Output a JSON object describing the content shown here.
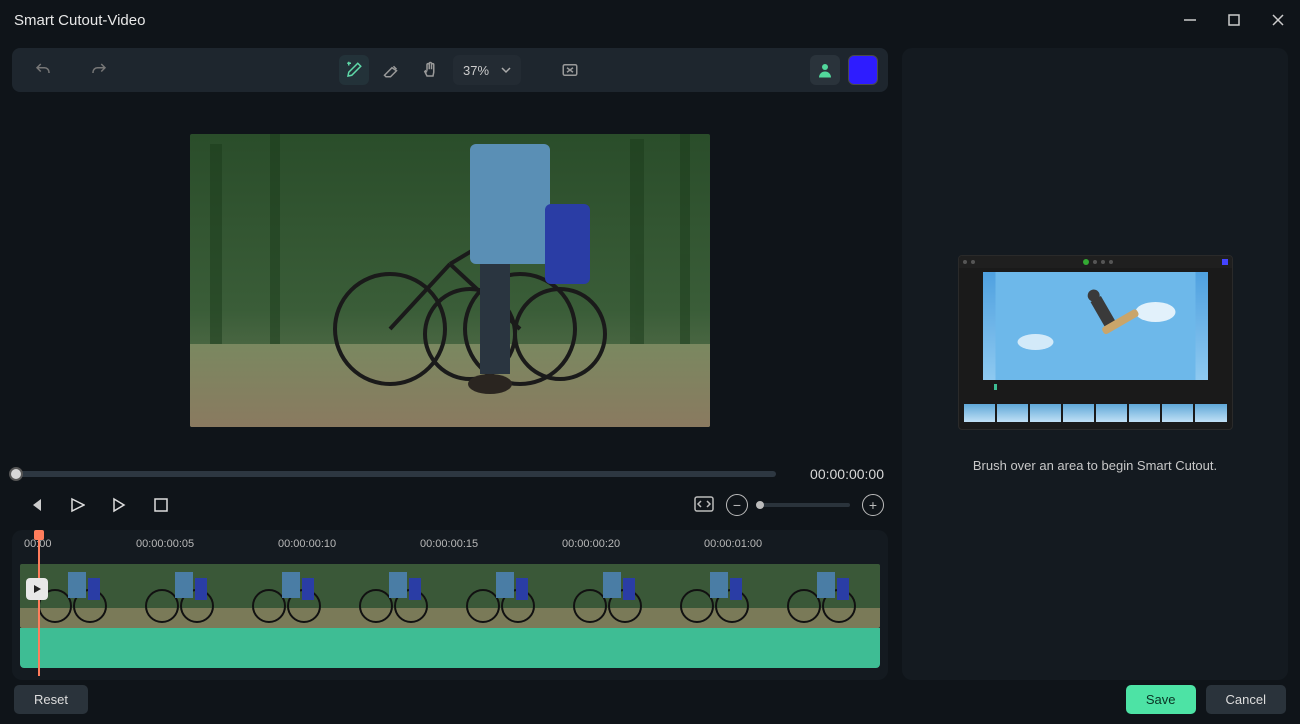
{
  "window": {
    "title": "Smart Cutout-Video"
  },
  "toolbar": {
    "zoom_value": "37%"
  },
  "playback": {
    "timecode": "00:00:00:00"
  },
  "timeline": {
    "marks": [
      "00:00",
      "00:00:00:05",
      "00:00:00:10",
      "00:00:00:15",
      "00:00:00:20",
      "00:00:01:00"
    ]
  },
  "help": {
    "message": "Brush over an area to begin Smart Cutout."
  },
  "buttons": {
    "reset": "Reset",
    "save": "Save",
    "cancel": "Cancel"
  },
  "colors": {
    "swatch": "#2e1cff",
    "accent": "#4de3a5"
  }
}
